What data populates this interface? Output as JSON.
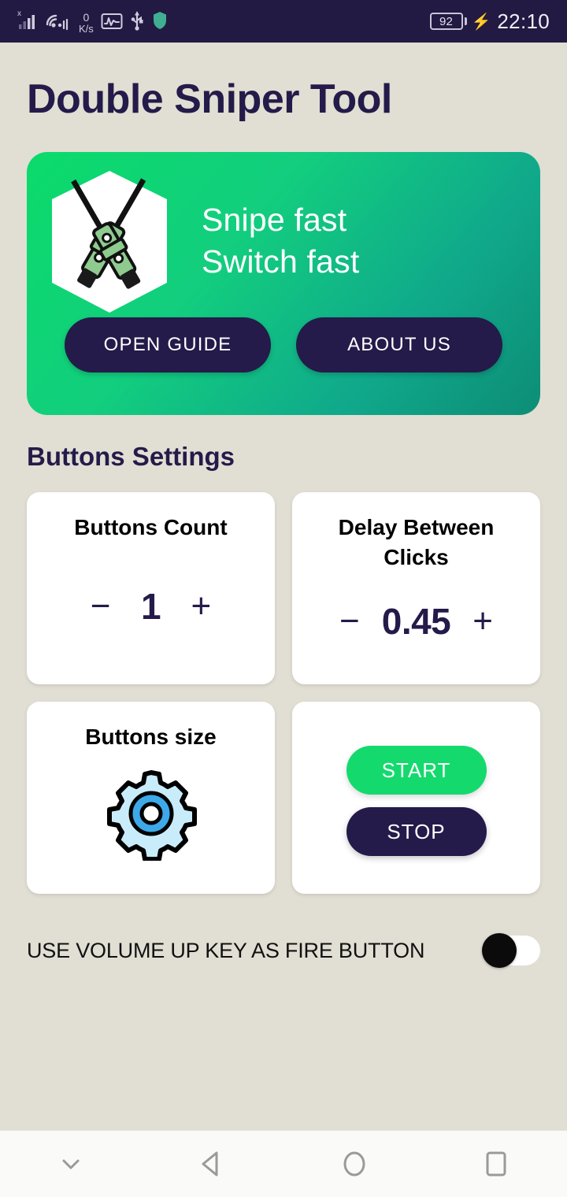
{
  "statusbar": {
    "network_speed_value": "0",
    "network_speed_unit": "K/s",
    "battery_level": "92",
    "time": "22:10",
    "icons": [
      "signal-x-icon",
      "wifi-hotspot-icon",
      "network-speed-icon",
      "activity-graph-icon",
      "usb-icon",
      "shield-icon",
      "battery-icon",
      "charging-bolt-icon"
    ]
  },
  "header": {
    "app_title": "Double Sniper Tool"
  },
  "banner": {
    "logo_icon": "crossed-sniper-rifles-logo",
    "line1": "Snipe fast",
    "line2": "Switch fast",
    "open_guide_label": "OPEN GUIDE",
    "about_us_label": "ABOUT US",
    "gradient_start": "#0BDB6A",
    "gradient_end": "#0D8D76",
    "button_color": "#241B4A"
  },
  "settings": {
    "section_title": "Buttons Settings",
    "buttons_count": {
      "title": "Buttons Count",
      "value": "1",
      "decrement_label": "−",
      "increment_label": "+"
    },
    "delay_between_clicks": {
      "title": "Delay Between Clicks",
      "value": "0.45",
      "decrement_label": "−",
      "increment_label": "+"
    },
    "buttons_size": {
      "title": "Buttons size",
      "icon": "gear-icon"
    },
    "run_controls": {
      "start_label": "START",
      "stop_label": "STOP",
      "start_color": "#14DA6E",
      "stop_color": "#241B4A"
    }
  },
  "volume_toggle": {
    "label": "USE VOLUME UP KEY AS FIRE BUTTON",
    "state": "off"
  },
  "navbar": {
    "items": [
      {
        "name": "hide-keyboard-icon"
      },
      {
        "name": "back-icon"
      },
      {
        "name": "home-icon"
      },
      {
        "name": "recents-icon"
      }
    ]
  }
}
